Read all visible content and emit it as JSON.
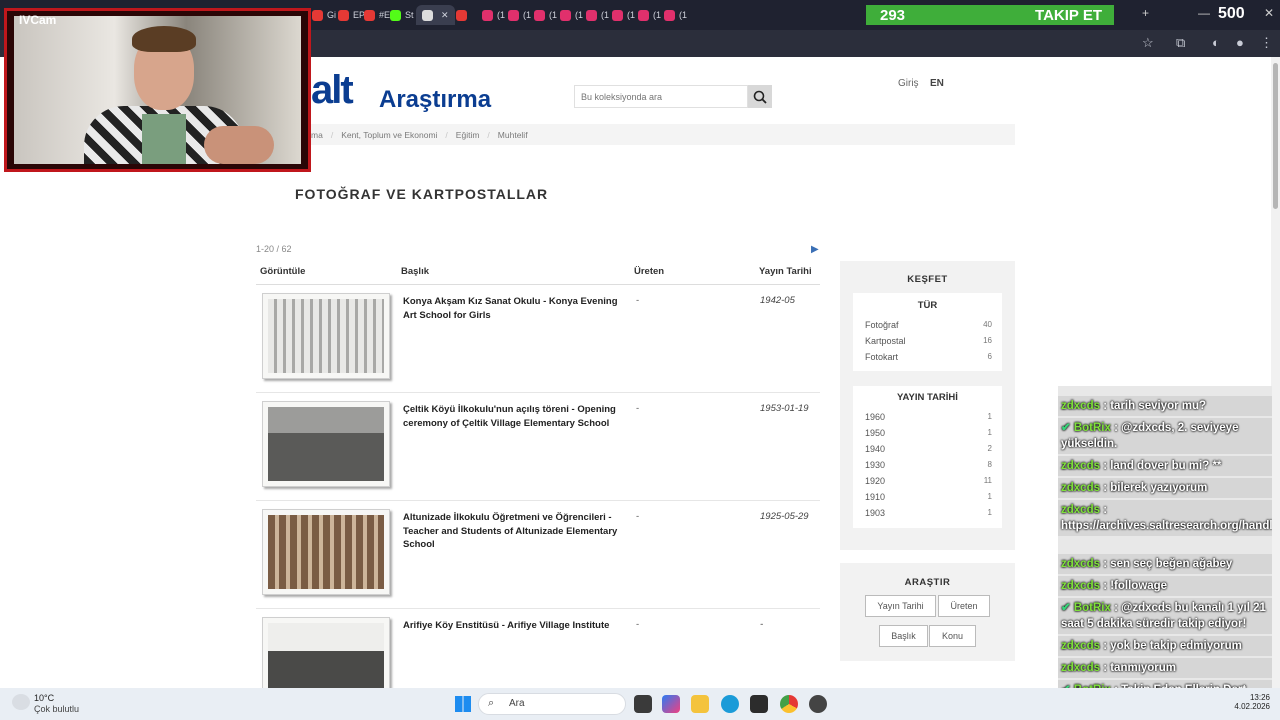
{
  "browser": {
    "tabs": [
      {
        "label": "Gi",
        "color": "#e53935"
      },
      {
        "label": "EP",
        "color": "#e53935"
      },
      {
        "label": "#E",
        "color": "#e53935"
      },
      {
        "label": "St",
        "color": "#53fc18"
      },
      {
        "label": "",
        "color": "#dddddd",
        "active": true
      },
      {
        "label": "",
        "color": "#e53935"
      },
      {
        "label": "(1",
        "color": "#e1306c"
      },
      {
        "label": "(1",
        "color": "#e1306c"
      },
      {
        "label": "(1",
        "color": "#e1306c"
      },
      {
        "label": "(1",
        "color": "#e1306c"
      },
      {
        "label": "(1",
        "color": "#e1306c"
      },
      {
        "label": "(1",
        "color": "#e1306c"
      },
      {
        "label": "(1",
        "color": "#e1306c"
      },
      {
        "label": "(1",
        "color": "#e1306c"
      }
    ],
    "active_tab_close": "✕"
  },
  "overlay": {
    "follow_count": "293",
    "follow_label": "TAKIP ET",
    "goal_count": "500",
    "webcam_label": "IVCam"
  },
  "site": {
    "logo": "alt",
    "logo_sub": "Araştırma",
    "search_placeholder": "Bu koleksiyonda ara",
    "login": "Giriş",
    "lang": "EN",
    "breadcrumb": [
      "ma",
      "Kent, Toplum ve Ekonomi",
      "Eğitim",
      "Muhtelif"
    ],
    "page_title": "FOTOĞRAF VE KARTPOSTALLAR",
    "count": "1-20 / 62",
    "columns": {
      "view": "Görüntüle",
      "title": "Başlık",
      "maker": "Üreten",
      "date": "Yayın Tarihi"
    },
    "items": [
      {
        "title": "Konya Akşam Kız Sanat Okulu - Konya Evening Art School for Girls",
        "maker": "-",
        "date": "1942-05"
      },
      {
        "title": "Çeltik Köyü İlkokulu'nun açılış töreni - Opening ceremony of Çeltik Village Elementary School",
        "maker": "-",
        "date": "1953-01-19"
      },
      {
        "title": "Altunizade İlkokulu Öğretmeni ve Öğrencileri - Teacher and Students of Altunizade Elementary School",
        "maker": "-",
        "date": "1925-05-29"
      },
      {
        "title": "Arifiye Köy Enstitüsü - Arifiye Village Institute",
        "maker": "-",
        "date": "-"
      }
    ],
    "explore": {
      "title": "KEŞFET",
      "type_title": "TÜR",
      "types": [
        {
          "label": "Fotoğraf",
          "count": "40"
        },
        {
          "label": "Kartpostal",
          "count": "16"
        },
        {
          "label": "Fotokart",
          "count": "6"
        }
      ],
      "date_title": "YAYIN TARİHİ",
      "dates": [
        {
          "label": "1960",
          "count": "1"
        },
        {
          "label": "1950",
          "count": "1"
        },
        {
          "label": "1940",
          "count": "2"
        },
        {
          "label": "1930",
          "count": "8"
        },
        {
          "label": "1920",
          "count": "11"
        },
        {
          "label": "1910",
          "count": "1"
        },
        {
          "label": "1903",
          "count": "1"
        }
      ]
    },
    "sort": {
      "title": "ARAŞTIR",
      "buttons": [
        "Yayın Tarihi",
        "Üreten",
        "Başlık",
        "Konu"
      ]
    }
  },
  "chat": [
    {
      "user": "zdxcds",
      "text": " : tarih seviyor mu?"
    },
    {
      "user": "BotRix",
      "text": " : @zdxcds, 2. seviyeye yükseldin.",
      "bot": true
    },
    {
      "user": "zdxcds",
      "text": " : land dover bu mi? **"
    },
    {
      "user": "zdxcds",
      "text": " : bilerek yazıyorum"
    },
    {
      "user": "zdxcds",
      "text": " : https://archives.saltresearch.org/handle/123456789/188929"
    },
    {
      "user": "zdxcds",
      "text": " : sen seç beğen ağabey"
    },
    {
      "user": "zdxcds",
      "text": " : !followage"
    },
    {
      "user": "BotRix",
      "text": " : @zdxcds bu kanalı 1 yıl 21 saat 5 dakika süredir takip ediyor!",
      "bot": true
    },
    {
      "user": "zdxcds",
      "text": " : yok be takip edmiyorum"
    },
    {
      "user": "zdxcds",
      "text": " : tanmıyorum"
    },
    {
      "user": "BotRix",
      "text": " : Takip Eden Ellerin Dert Görmesin Kral",
      "bot": true
    }
  ],
  "taskbar": {
    "temp": "10°C",
    "weather": "Çok bulutlu",
    "search": "Ara",
    "time": "13:26",
    "date": "4.02.2026"
  },
  "colors": {
    "brand": "#0b3d91",
    "follow_bar": "#3fae3a",
    "chat_user": "#7fe23b"
  }
}
